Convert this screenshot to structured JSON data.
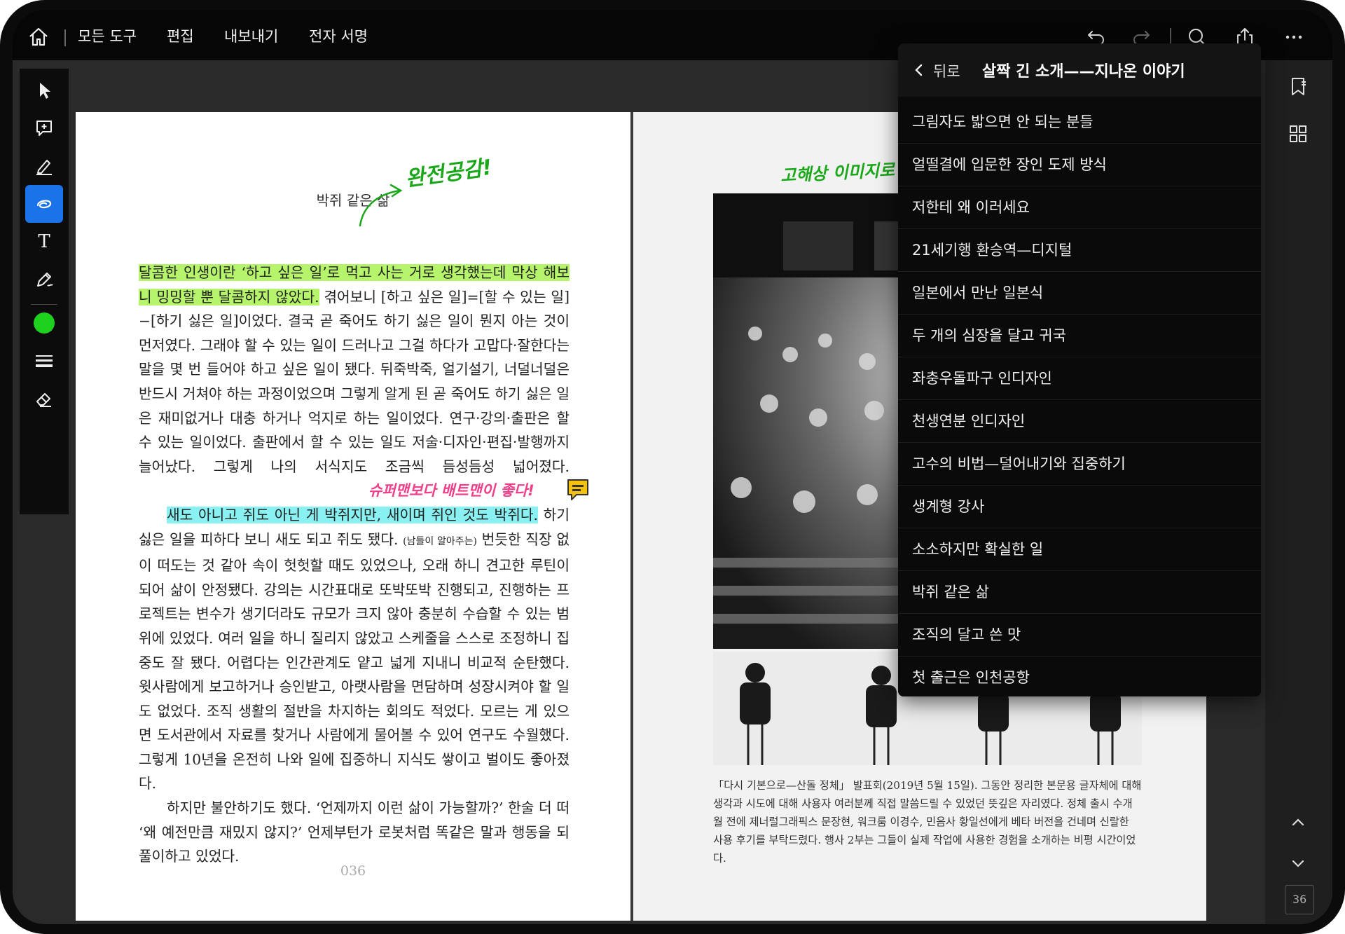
{
  "topbar": {
    "menu": [
      "모든 도구",
      "편집",
      "내보내기",
      "전자 서명"
    ]
  },
  "left_page": {
    "running_head": "박쥐 같은 삶",
    "folio": "036",
    "para1_hl": "달콤한 인생이란 ‘하고 싶은 일’로 먹고 사는 거로 생각했는데 막상 해보니 밍밍할 뿐 달콤하지 않았다.",
    "para1_rest": " 겪어보니 [하고 싶은 일]=[할 수 있는 일]−[하기 싫은 일]이었다. 결국 곧 죽어도 하기 싫은 일이 뭔지 아는 것이 먼저였다. 그래야 할 수 있는 일이 드러나고 그걸 하다가 고맙다·잘한다는 말을 몇 번 들어야 하고 싶은 일이 됐다. 뒤죽박죽, 얼기설기, 너덜너덜은 반드시 거쳐야 하는 과정이었으며 그렇게 알게 된 곧 죽어도 하기 싫은 일은 재미없거나 대충 하거나 억지로 하는 일이었다. 연구·강의·출판은 할 수 있는 일이었다. 출판에서 할 수 있는 일도 저술·디자인·편집·발행까지 늘어났다. 그렇게 나의 서식지도 조금씩 듬성듬성 넓어졌다.",
    "para2_hl": "새도 아니고 쥐도 아닌 게 박쥐지만, 새이며 쥐인 것도 박쥐다.",
    "para2_a": " 하기 싫은 일을 피하다 보니 새도 되고 쥐도 됐다. ",
    "para2_paren": "(남들이 알아주는)",
    "para2_b": " 번듯한 직장 없이 떠도는 것 같아 속이 헛헛할 때도 있었으나, 오래 하니 견고한 루틴이 되어 삶이 안정됐다. 강의는 시간표대로 또박또박 진행되고, 진행하는 프로젝트는 변수가 생기더라도 규모가 크지 않아 충분히 수습할 수 있는 범위에 있었다. 여러 일을 하니 질리지 않았고 스케줄을 스스로 조정하니 집중도 잘 됐다. 어렵다는 인간관계도 얕고 넓게 지내니 비교적 순탄했다. 윗사람에게 보고하거나 승인받고, 아랫사람을 면담하며 성장시켜야 할 일도 없었다. 조직 생활의 절반을 차지하는 회의도 적었다. 모르는 게 있으면 도서관에서 자료를 찾거나 사람에게 물어볼 수 있어 연구도 수월했다. 그렇게 10년을 온전히 나와 일에 집중하니 지식도 쌓이고 벌이도 좋아졌다.",
    "para3": "하지만 불안하기도 했다. ‘언제까지 이런 삶이 가능할까?’ 한술 더 떠 ‘왜 예전만큼 재밌지 않지?’ 언제부턴가 로봇처럼 똑같은 말과 행동을 되풀이하고 있었다.",
    "annotations": {
      "green_note": "완전공감!",
      "pink_note": "슈퍼맨보다 배트맨이 좋다!"
    }
  },
  "right_page": {
    "handwritten": "고해상 이미지로 변",
    "caption": "「다시 기본으로—산돌 정체」 발표회(2019년 5월 15일). 그동안 정리한 본문용 글자체에 대해 생각과 시도에 대해 사용자 여러분께 직접 말씀드릴 수 있었던 뜻깊은 자리였다. 정체 출시 수개월 전에 제너럴그래픽스 문장현, 워크룸 이경수, 민음사 황일선에게 베타 버전을 건네며 신랄한 사용 후기를 부탁드렸다. 행사 2부는 그들이 실제 작업에 사용한 경험을 소개하는 비평 시간이었다."
  },
  "toc": {
    "back_label": "뒤로",
    "title": "살짝 긴 소개——지나온 이야기",
    "items": [
      "그림자도 밟으면 안 되는 분들",
      "얼떨결에 입문한 장인 도제 방식",
      "저한테 왜 이러세요",
      "21세기행 환승역—디지털",
      "일본에서 만난 일본식",
      "두 개의 심장을 달고 귀국",
      "좌충우돌파구 인디자인",
      "천생연분 인디자인",
      "고수의 비법—덜어내기와 집중하기",
      "생계형 강사",
      "소소하지만 확실한 일",
      "박쥐 같은 삶",
      "조직의 달고 쓴 맛",
      "첫 출근은 인천공항"
    ]
  },
  "right_toolbar": {
    "page_number": "36"
  },
  "colors": {
    "accent": "#1a73e8",
    "highlight_green": "#b6f56b",
    "highlight_cyan": "#8af1f2",
    "ink_green": "#1aa81a",
    "ink_pink": "#ef3f8a",
    "active_color": "#1fd11f"
  },
  "icons": [
    "home-icon",
    "undo-icon",
    "redo-icon",
    "search-icon",
    "share-icon",
    "more-icon",
    "select-arrow-icon",
    "add-comment-icon",
    "highlighter-icon",
    "lasso-icon",
    "text-tool-icon",
    "pen-tool-icon",
    "color-swatch",
    "stroke-width-icon",
    "eraser-icon",
    "bookmark-icon",
    "thumbnails-icon",
    "chevron-up-icon",
    "chevron-down-icon",
    "chevron-left-icon",
    "note-icon"
  ]
}
